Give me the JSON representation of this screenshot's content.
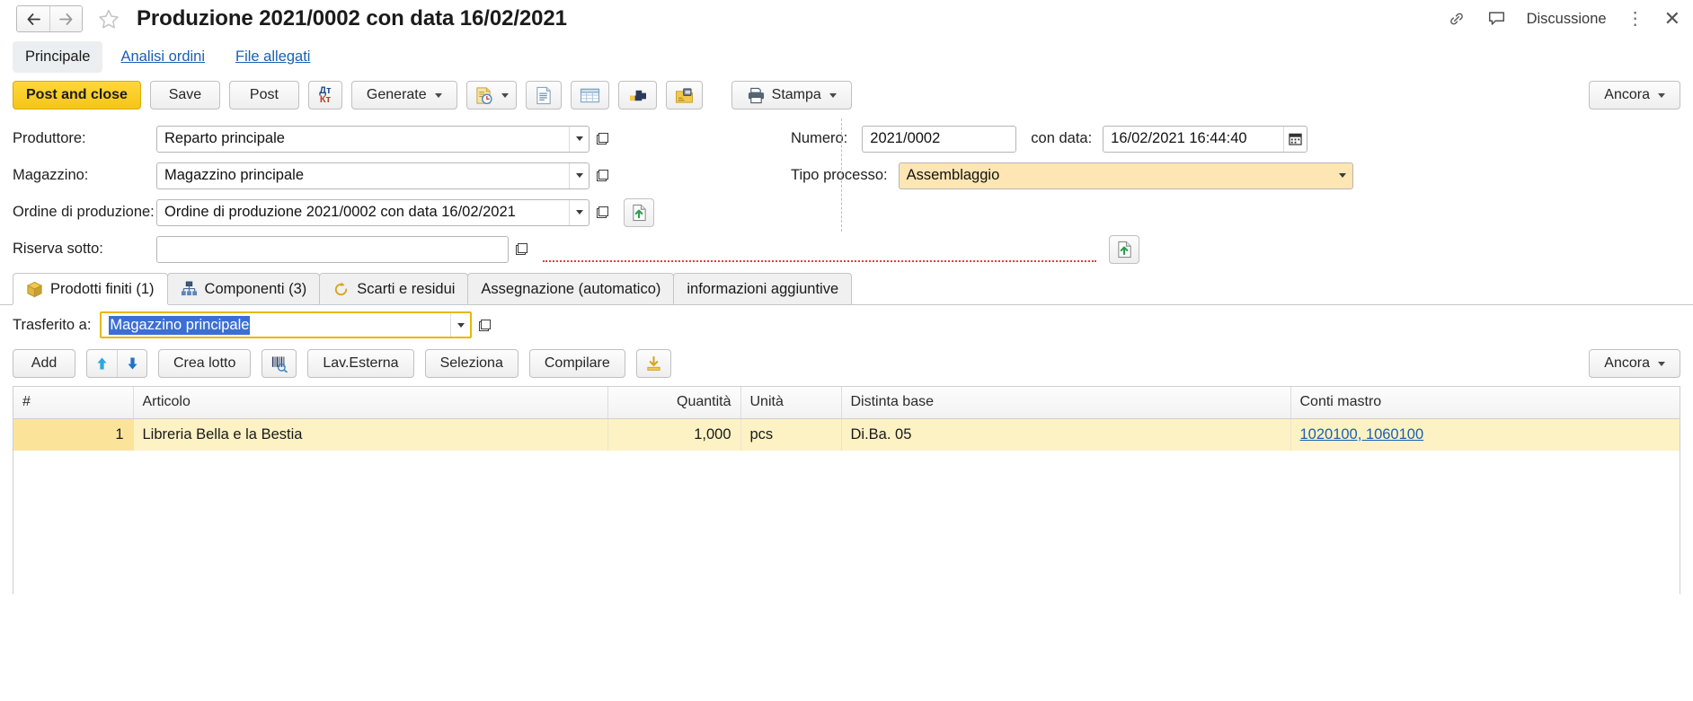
{
  "window": {
    "title": "Produzione 2021/0002 con data 16/02/2021",
    "back_icon": "arrow-left-icon",
    "forward_icon": "arrow-right-icon",
    "favorite_icon": "star-icon",
    "link_icon": "link-icon",
    "discussion_icon": "comment-icon",
    "discussion_label": "Discussione",
    "more_icon": "kebab-menu-icon",
    "close_icon": "close-icon"
  },
  "page_tabs": [
    {
      "label": "Principale",
      "active": true
    },
    {
      "label": "Analisi ordini",
      "active": false
    },
    {
      "label": "File allegati",
      "active": false
    }
  ],
  "toolbar": {
    "post_and_close": "Post and close",
    "save": "Save",
    "post": "Post",
    "dtkt_dt": "Дт",
    "dtkt_kt": "Кт",
    "generate": "Generate",
    "stampa": "Stampa",
    "ancora": "Ancora",
    "icons": {
      "dtkt": "debit-credit-icon",
      "report_clock": "report-schedule-icon",
      "document_list": "document-report-icon",
      "table": "table-report-icon",
      "blocks": "structure-blocks-icon",
      "folder_lock": "folder-secure-icon",
      "printer": "printer-icon"
    }
  },
  "form": {
    "produttore_label": "Produttore:",
    "produttore_value": "Reparto principale",
    "magazzino_label": "Magazzino:",
    "magazzino_value": "Magazzino principale",
    "ordine_label": "Ordine di produzione:",
    "ordine_value": "Ordine di produzione 2021/0002 con data 16/02/2021",
    "riserva_label": "Riserva sotto:",
    "riserva_value": "",
    "numero_label": "Numero:",
    "numero_value": "2021/0002",
    "condata_label": "con data:",
    "condata_value": "16/02/2021 16:44:40",
    "calendar_icon": "calendar-icon",
    "tipo_processo_label": "Tipo processo:",
    "tipo_processo_value": "Assemblaggio",
    "fill_icon": "fill-from-document-icon",
    "open_icon": "open-record-icon",
    "dropdown_icon": "chevron-down-icon"
  },
  "bottom_tabs": [
    {
      "label": "Prodotti finiti (1)",
      "icon": "box-icon",
      "active": true
    },
    {
      "label": "Componenti (3)",
      "icon": "hierarchy-icon",
      "active": false
    },
    {
      "label": "Scarti e residui",
      "icon": "recycle-icon",
      "active": false
    },
    {
      "label": "Assegnazione (automatico)",
      "icon": "",
      "active": false
    },
    {
      "label": "informazioni aggiuntive",
      "icon": "",
      "active": false
    }
  ],
  "transfer": {
    "label": "Trasferito a:",
    "value": "Magazzino principale"
  },
  "grid_toolbar": {
    "add": "Add",
    "move_up_icon": "arrow-up-icon",
    "move_down_icon": "arrow-down-icon",
    "crea_lotto": "Crea lotto",
    "barcode_icon": "barcode-scan-icon",
    "lav_esterna": "Lav.Esterna",
    "seleziona": "Seleziona",
    "compilare": "Compilare",
    "download_icon": "download-icon",
    "ancora": "Ancora"
  },
  "table": {
    "columns": [
      "#",
      "Articolo",
      "Quantità",
      "Unità",
      "Distinta base",
      "Conti mastro"
    ],
    "rows": [
      {
        "num": "1",
        "articolo": "Libreria Bella e la Bestia",
        "quantita": "1,000",
        "unita": "pcs",
        "distinta": "Di.Ba. 05",
        "conti": "1020100, 1060100"
      }
    ]
  },
  "colors": {
    "accent_yellow": "#f5c518",
    "row_highlight": "#fdf2c4",
    "required_field": "#fde6b3",
    "link": "#1a5fb4",
    "focus_border": "#e8b800",
    "selection": "#3b6fd4"
  }
}
